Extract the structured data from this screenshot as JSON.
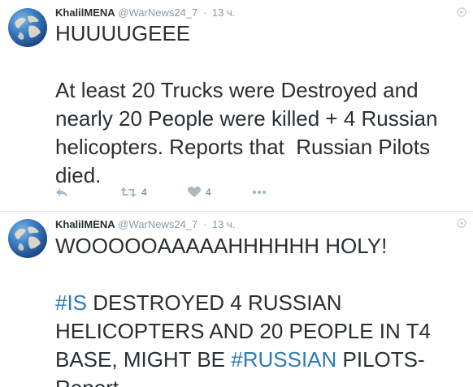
{
  "tweets": [
    {
      "author_name": "KhalilMENA",
      "handle": "@WarNews24_7",
      "separator": "·",
      "time": "13 ч.",
      "text_lines": [
        "HUUUUGEEE",
        "",
        "At least 20 Trucks were Destroyed and",
        "nearly 20 People were killed + 4 Russian",
        "helicopters. Reports that  Russian Pilots",
        "died."
      ],
      "retweet_count": "4",
      "like_count": "4"
    },
    {
      "author_name": "KhalilMENA",
      "handle": "@WarNews24_7",
      "separator": "·",
      "time": "13 ч.",
      "line1": "WOOOOOAAAAAHHHHHH HOLY!",
      "hashtag1": "#IS",
      "line3_rest": " DESTROYED 4 RUSSIAN",
      "line4": "HELICOPTERS AND 20 PEOPLE IN T4",
      "line5_start": "BASE, MIGHT BE ",
      "hashtag2": "#RUSSIAN",
      "line5_end": " PILOTS-",
      "line6": "Report"
    }
  ],
  "colors": {
    "text": "#292f33",
    "meta": "#8899a6",
    "hashtag": "#2b7bb9",
    "icon": "#aab8c2",
    "divider": "#e1e8ed"
  },
  "icons": [
    "globe-avatar",
    "options-icon",
    "reply-icon",
    "retweet-icon",
    "heart-icon",
    "more-dots-icon"
  ]
}
